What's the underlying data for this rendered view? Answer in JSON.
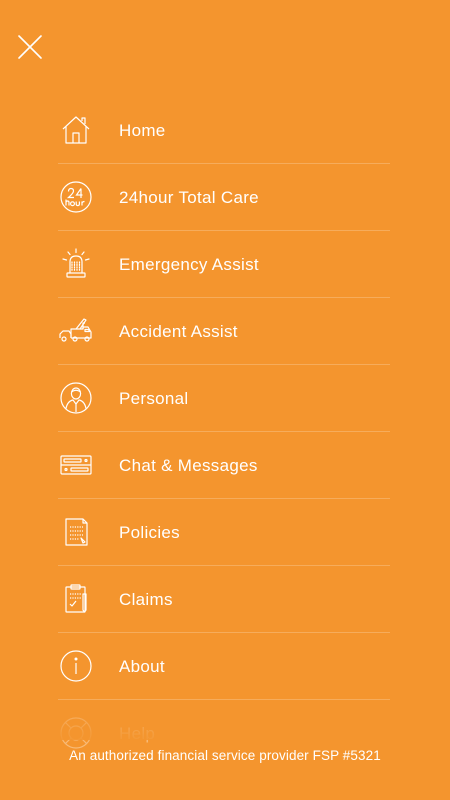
{
  "theme": {
    "background": "#f4952e",
    "foreground": "#ffffff"
  },
  "close_button": {
    "icon": "close-icon"
  },
  "menu": {
    "items": [
      {
        "label": "Home",
        "icon": "home-icon"
      },
      {
        "label": "24hour Total Care",
        "icon": "24-hour-icon"
      },
      {
        "label": "Emergency Assist",
        "icon": "siren-icon"
      },
      {
        "label": "Accident Assist",
        "icon": "tow-truck-icon"
      },
      {
        "label": "Personal",
        "icon": "person-icon"
      },
      {
        "label": "Chat & Messages",
        "icon": "chat-icon"
      },
      {
        "label": "Policies",
        "icon": "policy-document-icon"
      },
      {
        "label": "Claims",
        "icon": "claim-document-icon"
      },
      {
        "label": "About",
        "icon": "info-icon"
      },
      {
        "label": "Help",
        "icon": "lifebuoy-icon"
      }
    ]
  },
  "footer": {
    "text": "An authorized financial service provider FSP #5321"
  }
}
